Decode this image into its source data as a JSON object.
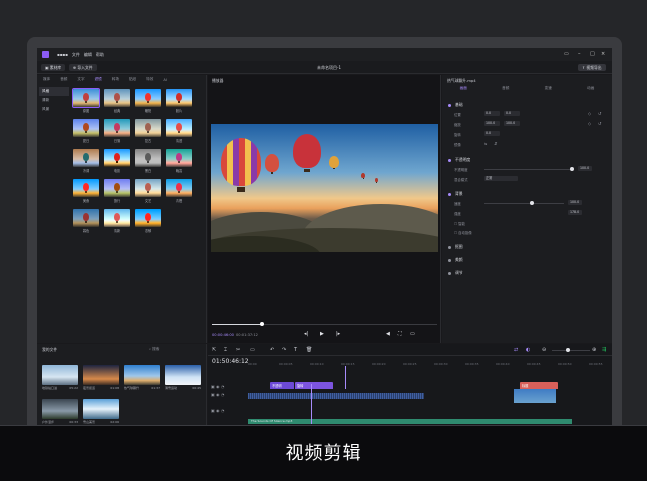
{
  "app": {
    "menu": [
      "文件",
      "编辑",
      "帮助"
    ],
    "project_title": "未命名项目-1",
    "toolbar": {
      "media_btn": "素材库",
      "import_btn": "导入文件",
      "export_btn": "视频导出"
    }
  },
  "left_panel": {
    "tabs": [
      "媒体",
      "音频",
      "文字",
      "滤镜",
      "转场",
      "贴纸",
      "特效",
      "AI"
    ],
    "active_tab": 3,
    "categories": [
      "风格",
      "清新",
      "风景"
    ],
    "tiles": [
      "原图",
      "经典",
      "暖阳",
      "胶片",
      "夏日",
      "日落",
      "复古",
      "清透",
      "冷调",
      "电影",
      "黑白",
      "晚霞",
      "美食",
      "旅行",
      "文艺",
      "青橙",
      "暮色",
      "清新",
      "浓郁"
    ]
  },
  "player": {
    "title": "播放器",
    "time_current": "00:00:46:00",
    "time_total": "00:01:37:12"
  },
  "right_panel": {
    "title": "热气球飘升.mp4",
    "tabs": [
      "画面",
      "音频",
      "变速",
      "动画"
    ],
    "sections": {
      "basic": "基础",
      "blend": "不透明度",
      "mask": "背景",
      "keying": "抠图",
      "beauty": "美颜",
      "adjust": "调节"
    },
    "props": {
      "position": "位置",
      "scale": "缩放",
      "rotate": "旋转",
      "flip": "镜像",
      "opacity": "不透明度",
      "blend_mode": "混合模式",
      "blend_value": "正常",
      "speed": "速度",
      "intensity": "强度"
    },
    "values": {
      "pos_x": "0.0",
      "pos_y": "0.0",
      "scale_w": "100.0",
      "scale_h": "100.0",
      "rotate": "0.0",
      "opacity": "100.0",
      "speed": "100.0",
      "intensity": "178.0"
    },
    "checks": [
      "智能",
      "自动抠像"
    ]
  },
  "media_library": {
    "title": "我的文件",
    "search": "搜索",
    "items": [
      {
        "name": "地铁站口进",
        "dur": "05:22"
      },
      {
        "name": "夜景街道",
        "dur": "01:08"
      },
      {
        "name": "热气球飘升",
        "dur": "01:37"
      },
      {
        "name": "滑雪运动",
        "dur": "00:45"
      },
      {
        "name": "户外漫步",
        "dur": "00:33"
      },
      {
        "name": "雪山美景",
        "dur": "02:06"
      }
    ]
  },
  "timeline": {
    "timecode": "01:50:46:12",
    "ruler": [
      "00:00",
      "00:00:05",
      "00:00:10",
      "00:00:15",
      "00:00:20",
      "00:00:25",
      "00:00:30",
      "00:00:35",
      "00:00:40",
      "00:00:45",
      "00:00:50",
      "00:00:55"
    ],
    "clips": {
      "a": "不透明",
      "b": "旋转",
      "c": "曲线",
      "d": "文字",
      "e": "标题"
    },
    "audio_label": "The Sounds Of Silence.mp3"
  },
  "caption": "视频剪辑"
}
